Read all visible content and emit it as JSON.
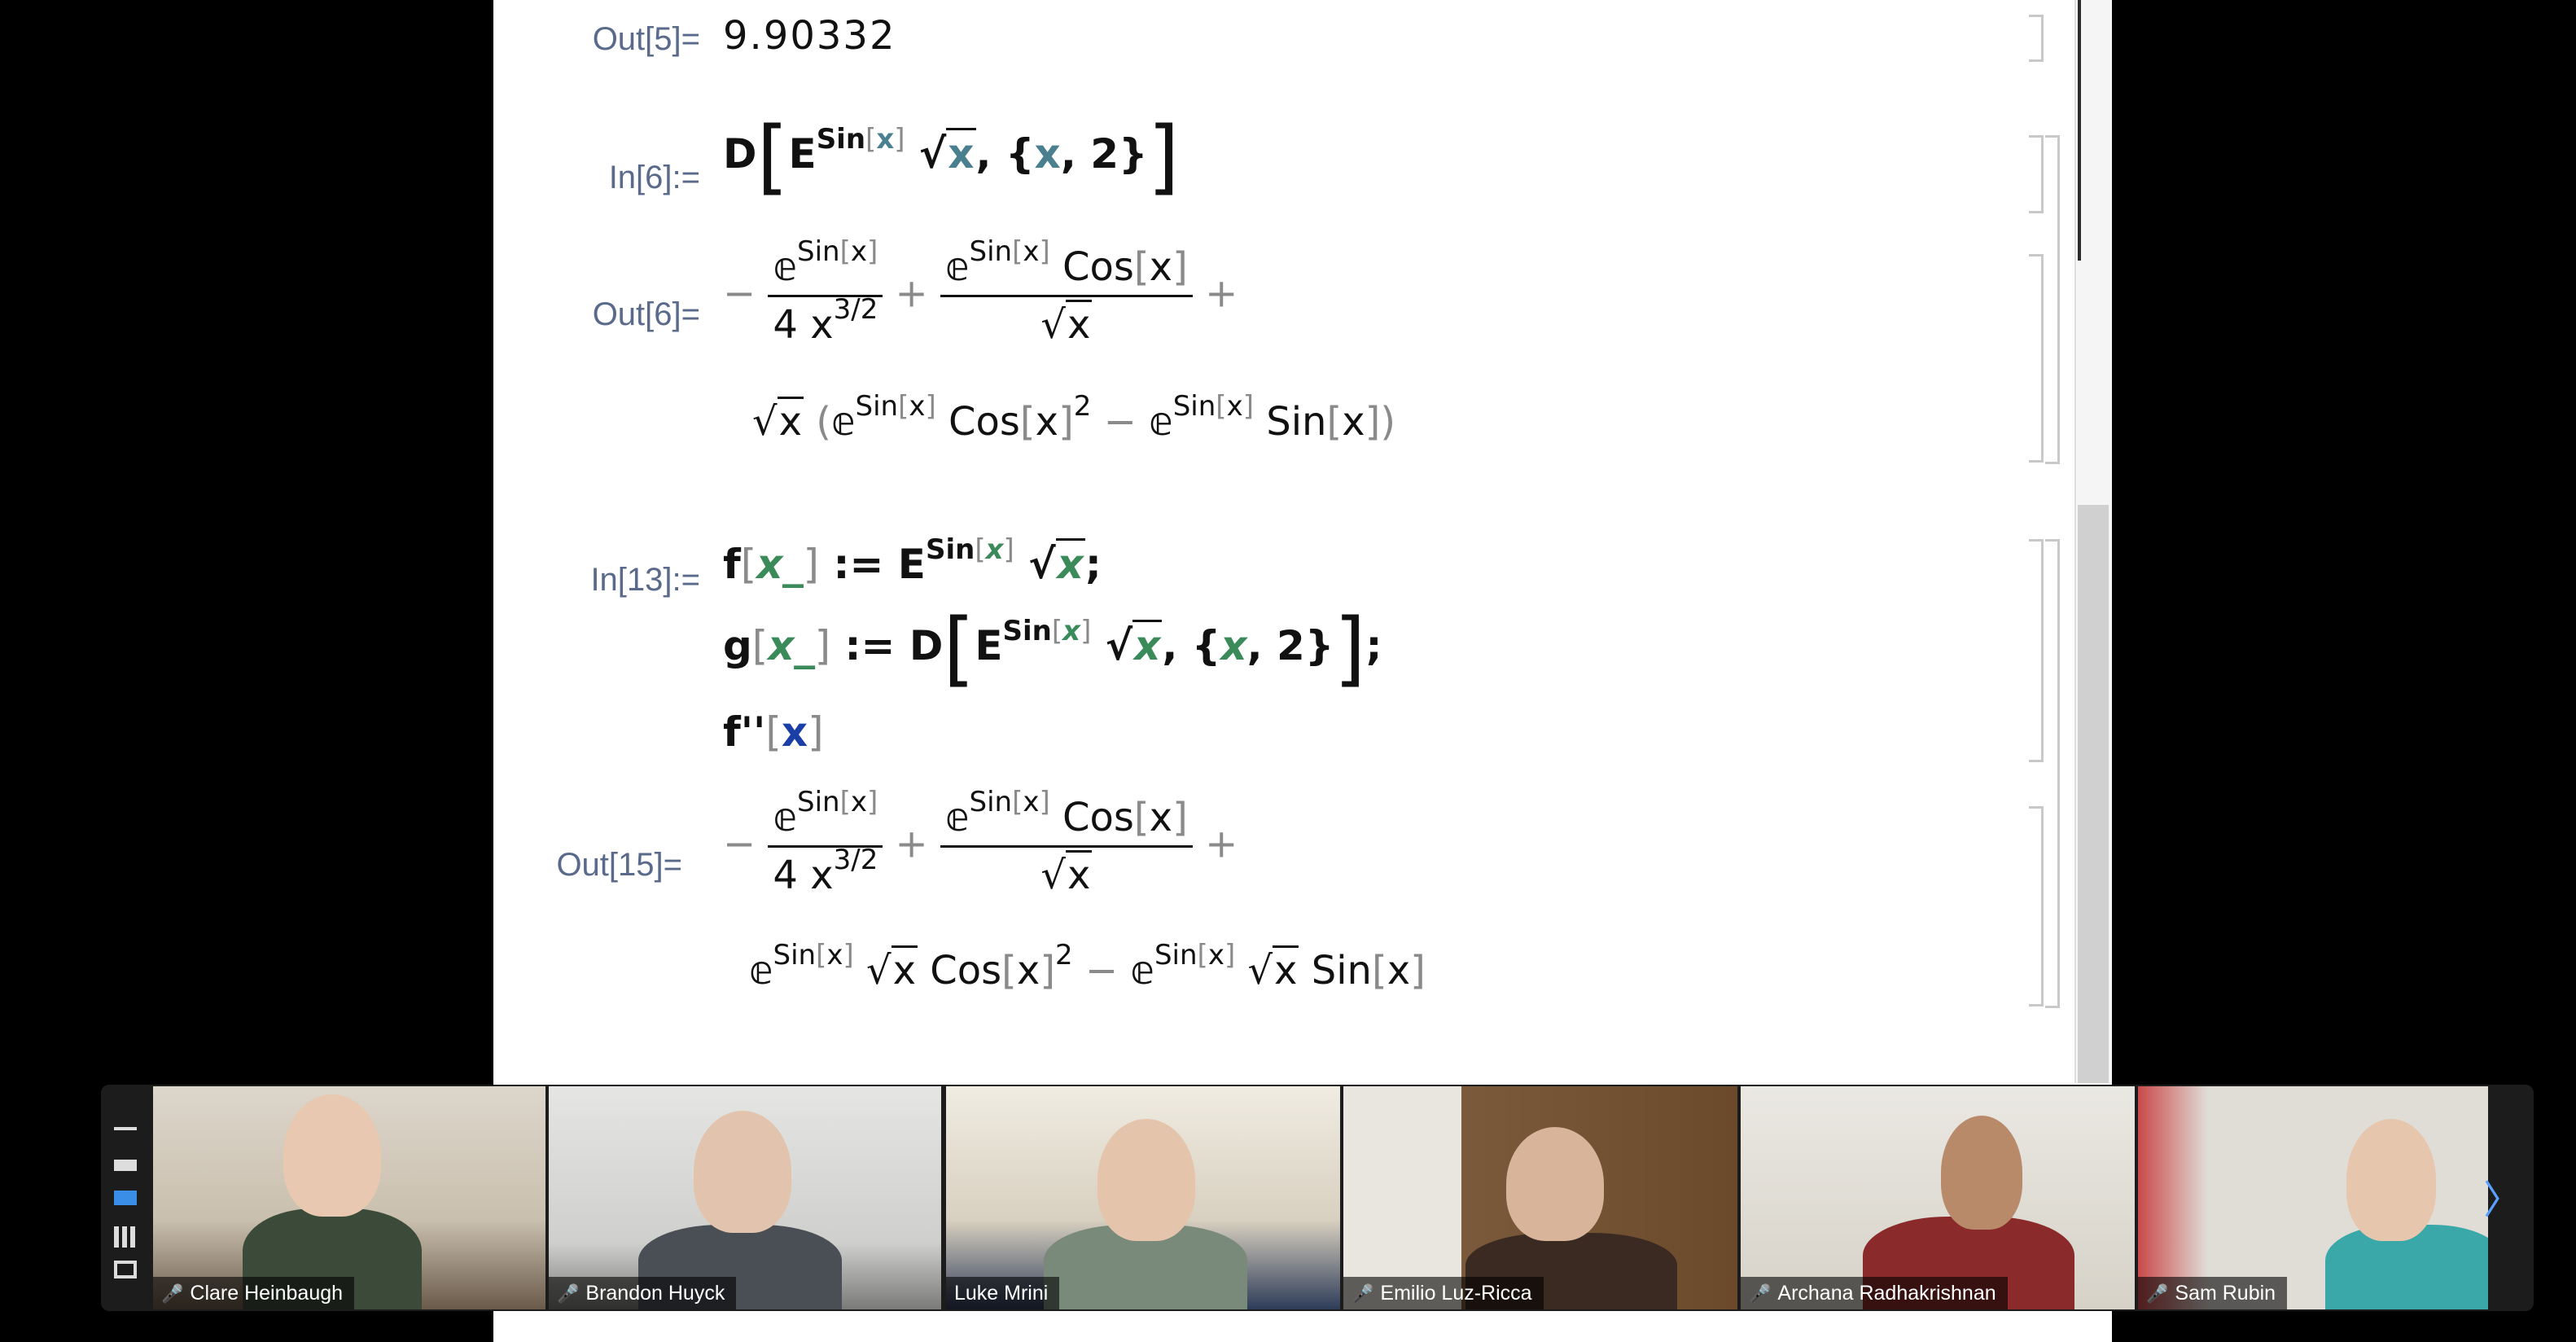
{
  "notebook": {
    "cells": [
      {
        "label": "Out[5]=",
        "kind": "out",
        "value": "9.90332"
      },
      {
        "label": "In[6]:=",
        "kind": "in"
      },
      {
        "label": "Out[6]=",
        "kind": "out"
      },
      {
        "label": "In[13]:=",
        "kind": "in"
      },
      {
        "label": "Out[15]=",
        "kind": "out"
      }
    ],
    "in6": {
      "D": "D",
      "E": "E",
      "exp": "Sin",
      "expArg": "x",
      "var": "x",
      "order": "2"
    },
    "out6": {
      "e": "e",
      "sin": "Sin",
      "cos": "Cos",
      "x": "x",
      "four": "4",
      "pow": "3/2",
      "sq": "2"
    },
    "in13": {
      "f": "f",
      "g": "g",
      "arg": "x_",
      "assign": ":=",
      "fpp": "f''",
      "x": "x"
    },
    "out15": {
      "e": "e",
      "sin": "Sin",
      "cos": "Cos",
      "x": "x",
      "four": "4",
      "pow": "3/2",
      "sq": "2"
    }
  },
  "participants": [
    {
      "name": "Clare Heinbaugh",
      "muted": true
    },
    {
      "name": "Brandon Huyck",
      "muted": true
    },
    {
      "name": "Luke Mrini",
      "muted": false,
      "active": true
    },
    {
      "name": "Emilio Luz-Ricca",
      "muted": true
    },
    {
      "name": "Archana Radhakrishnan",
      "muted": true
    },
    {
      "name": "Sam Rubin",
      "muted": true
    }
  ],
  "icons": {
    "mic_muted": "mic-muted-icon",
    "next": "chevron-right-icon",
    "close": "close-icon"
  },
  "colors": {
    "label": "#5a6a8a",
    "variable": "#4a7f8f",
    "pattern": "#3a8a5a",
    "active_speaker": "#e6e27a",
    "muted_mic": "#e0392b"
  }
}
